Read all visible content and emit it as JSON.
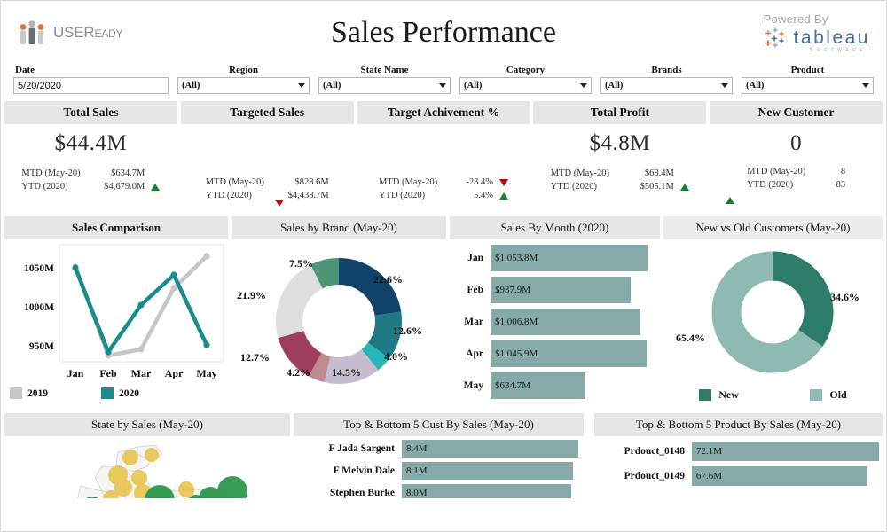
{
  "branding": {
    "left_logo_name": "USEReady",
    "left_logo_main": "USER",
    "left_logo_suffix": "EADY",
    "powered_by": "Powered By",
    "tableau_word": "tableau",
    "tableau_sub": "SOFTWARE"
  },
  "header": {
    "title": "Sales Performance"
  },
  "filters": [
    {
      "label": "Date",
      "value": "5/20/2020",
      "type": "date"
    },
    {
      "label": "Region",
      "value": "(All)",
      "type": "dropdown"
    },
    {
      "label": "State Name",
      "value": "(All)",
      "type": "dropdown"
    },
    {
      "label": "Category",
      "value": "(All)",
      "type": "dropdown"
    },
    {
      "label": "Brands",
      "value": "(All)",
      "type": "dropdown"
    },
    {
      "label": "Product",
      "value": "(All)",
      "type": "dropdown"
    }
  ],
  "kpis": [
    {
      "title": "Total Sales",
      "big": "$44.4M",
      "rows": [
        {
          "label": "MTD (May-20)",
          "value": "$634.7M",
          "trend": "none"
        },
        {
          "label": "YTD  (2020)",
          "value": "$4,679.0M",
          "trend": "up"
        }
      ]
    },
    {
      "title": "Targeted Sales",
      "big": "",
      "rows": [
        {
          "label": "MTD (May-20)",
          "value": "$828.6M",
          "trend": "none"
        },
        {
          "label": "YTD  (2020)",
          "value": "$4,438.7M",
          "trend": "none"
        }
      ],
      "float_trend": "down"
    },
    {
      "title": "Target Achivement %",
      "big": "",
      "rows": [
        {
          "label": "MTD (May-20)",
          "value": "-23.4%",
          "trend": "down"
        },
        {
          "label": "YTD  (2020)",
          "value": "5.4%",
          "trend": "up"
        }
      ]
    },
    {
      "title": "Total Profit",
      "big": "$4.8M",
      "rows": [
        {
          "label": "MTD (May-20)",
          "value": "$68.4M",
          "trend": "none"
        },
        {
          "label": "YTD  (2020)",
          "value": "$505.1M",
          "trend": "up"
        }
      ]
    },
    {
      "title": "New Customer",
      "big": "0",
      "rows": [
        {
          "label": "MTD (May-20)",
          "value": "8",
          "trend": "none"
        },
        {
          "label": "YTD  (2020)",
          "value": "83",
          "trend": "none"
        }
      ],
      "float_trend": "up"
    }
  ],
  "panels": {
    "sales_comparison": {
      "title": "Sales Comparison"
    },
    "sales_by_brand": {
      "title": "Sales by Brand (May-20)"
    },
    "sales_by_month": {
      "title": "Sales By Month (2020)"
    },
    "new_vs_old": {
      "title": "New vs Old Customers (May-20)"
    },
    "state_by_sales": {
      "title": "State by Sales (May-20)"
    },
    "top_bottom_cust": {
      "title": "Top & Bottom 5 Cust By Sales (May-20)"
    },
    "top_bottom_product": {
      "title": "Top & Bottom 5 Product By Sales (May-20)"
    }
  },
  "chart_data": [
    {
      "id": "sales_comparison",
      "type": "line",
      "title": "Sales Comparison",
      "xlabel": "",
      "ylabel": "",
      "categories": [
        "Jan",
        "Feb",
        "Mar",
        "Apr",
        "May"
      ],
      "yticks": [
        "950M",
        "1000M",
        "1050M"
      ],
      "ylim": [
        930,
        1075
      ],
      "grid": false,
      "legend_position": "bottom",
      "series": [
        {
          "name": "2019",
          "color": "#c6c6c6",
          "values": [
            1051,
            938,
            946,
            1033,
            1066
          ]
        },
        {
          "name": "2020",
          "color": "#1b8c8c",
          "values": [
            1050,
            943,
            1002,
            1047,
            951
          ]
        }
      ]
    },
    {
      "id": "sales_by_brand",
      "type": "pie",
      "title": "Sales by Brand (May-20)",
      "donut": true,
      "labels": [
        "22.6%",
        "12.6%",
        "4.0%",
        "14.5%",
        "4.2%",
        "12.7%",
        "21.9%",
        "7.5%"
      ],
      "values": [
        22.6,
        12.6,
        4.0,
        14.5,
        4.2,
        12.7,
        21.9,
        7.5
      ],
      "colors": [
        "#10436b",
        "#1f7a85",
        "#25b7b7",
        "#c5bcd0",
        "#c08a92",
        "#9e3d5c",
        "#dedede",
        "#4e9476"
      ]
    },
    {
      "id": "sales_by_month",
      "type": "bar",
      "orientation": "horizontal",
      "title": "Sales By Month (2020)",
      "categories": [
        "Jan",
        "Feb",
        "Mar",
        "Apr",
        "May"
      ],
      "value_labels": [
        "$1,053.8M",
        "$937.9M",
        "$1,006.8M",
        "$1,045.9M",
        "$634.7M"
      ],
      "values": [
        1053.8,
        937.9,
        1006.8,
        1045.9,
        634.7
      ],
      "xlim": [
        0,
        1100
      ],
      "bar_color": "#85aaa8",
      "grid": false
    },
    {
      "id": "new_vs_old",
      "type": "pie",
      "title": "New vs Old Customers (May-20)",
      "donut": true,
      "labels": [
        "34.6%",
        "65.4%"
      ],
      "legend": [
        "New",
        "Old"
      ],
      "values": [
        34.6,
        65.4
      ],
      "colors": [
        "#2e7d6b",
        "#8fbab3"
      ],
      "legend_position": "bottom"
    },
    {
      "id": "state_by_sales",
      "type": "map",
      "title": "State by Sales (May-20)",
      "marker_colors": [
        "#e8c24a",
        "#1e8f3e"
      ],
      "note": "US state bubble map"
    },
    {
      "id": "top_bottom_cust",
      "type": "bar",
      "orientation": "horizontal",
      "title": "Top & Bottom 5 Cust By Sales (May-20)",
      "categories": [
        "F Jada Sargent",
        "F Melvin Dale",
        "Stephen  Burke"
      ],
      "value_labels": [
        "8.4M",
        "8.1M",
        "8.0M"
      ],
      "values": [
        8.4,
        8.1,
        8.0
      ],
      "xlim": [
        0,
        8.7
      ],
      "bar_color": "#85aaa8"
    },
    {
      "id": "top_bottom_product",
      "type": "bar",
      "orientation": "horizontal",
      "title": "Top & Bottom 5 Product By Sales (May-20)",
      "categories": [
        "Prdouct_0148",
        "Prdouct_0149"
      ],
      "value_labels": [
        "72.1M",
        "67.6M"
      ],
      "values": [
        72.1,
        67.6
      ],
      "xlim": [
        0,
        75
      ],
      "bar_color": "#85aaa8"
    }
  ]
}
